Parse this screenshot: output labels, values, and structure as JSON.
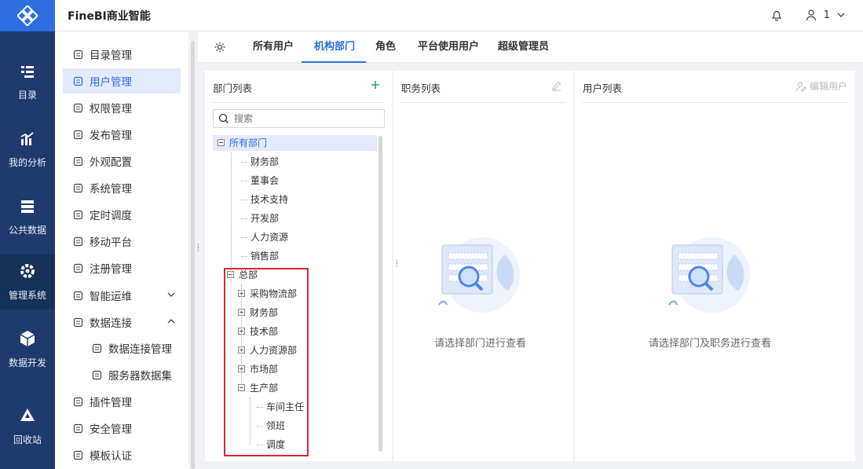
{
  "app": {
    "title": "FineBI商业智能",
    "user": "1"
  },
  "rail": [
    {
      "label": "目录",
      "icon": "catalog-icon"
    },
    {
      "label": "我的分析",
      "icon": "analysis-icon"
    },
    {
      "label": "公共数据",
      "icon": "public-data-icon"
    },
    {
      "label": "管理系统",
      "icon": "management-icon",
      "active": true
    },
    {
      "label": "数据开发",
      "icon": "data-dev-icon"
    },
    {
      "label": "回收站",
      "icon": "recycle-icon"
    }
  ],
  "nav": {
    "items": [
      {
        "label": "目录管理",
        "icon": "catalog-manage-icon"
      },
      {
        "label": "用户管理",
        "icon": "user-manage-icon",
        "active": true
      },
      {
        "label": "权限管理",
        "icon": "permission-icon"
      },
      {
        "label": "发布管理",
        "icon": "publish-icon"
      },
      {
        "label": "外观配置",
        "icon": "appearance-icon"
      },
      {
        "label": "系统管理",
        "icon": "system-gear-icon"
      },
      {
        "label": "定时调度",
        "icon": "timer-icon"
      },
      {
        "label": "移动平台",
        "icon": "mobile-icon"
      },
      {
        "label": "注册管理",
        "icon": "register-icon"
      },
      {
        "label": "智能运维",
        "icon": "ops-icon",
        "caret": "down"
      },
      {
        "label": "数据连接",
        "icon": "link-icon",
        "caret": "up"
      },
      {
        "label": "数据连接管理",
        "icon": "db-link-icon",
        "sub": true
      },
      {
        "label": "服务器数据集",
        "icon": "server-dataset-icon",
        "sub": true
      },
      {
        "label": "插件管理",
        "icon": "plugin-icon"
      },
      {
        "label": "安全管理",
        "icon": "security-icon"
      },
      {
        "label": "模板认证",
        "icon": "template-cert-icon"
      }
    ]
  },
  "tabs": [
    "所有用户",
    "机构部门",
    "角色",
    "平台使用用户",
    "超级管理员"
  ],
  "active_tab": "机构部门",
  "dept_panel": {
    "title": "部门列表",
    "search_placeholder": "搜索",
    "tree": [
      {
        "label": "所有部门",
        "level": 0,
        "toggle": "minus",
        "selected": true
      },
      {
        "label": "财务部",
        "level": 1
      },
      {
        "label": "董事会",
        "level": 1
      },
      {
        "label": "技术支持",
        "level": 1
      },
      {
        "label": "开发部",
        "level": 1
      },
      {
        "label": "人力资源",
        "level": 1
      },
      {
        "label": "销售部",
        "level": 1
      },
      {
        "label": "总部",
        "level": 1,
        "toggle": "minus"
      },
      {
        "label": "采购物流部",
        "level": 2,
        "toggle": "plus"
      },
      {
        "label": "财务部",
        "level": 2,
        "toggle": "plus"
      },
      {
        "label": "技术部",
        "level": 2,
        "toggle": "plus"
      },
      {
        "label": "人力资源部",
        "level": 2,
        "toggle": "plus"
      },
      {
        "label": "市场部",
        "level": 2,
        "toggle": "plus"
      },
      {
        "label": "生产部",
        "level": 2,
        "toggle": "minus"
      },
      {
        "label": "车间主任",
        "level": 3
      },
      {
        "label": "领班",
        "level": 3
      },
      {
        "label": "调度",
        "level": 3
      }
    ]
  },
  "position_panel": {
    "title": "职务列表",
    "empty_text": "请选择部门进行查看"
  },
  "user_panel": {
    "title": "用户列表",
    "edit_label": "编辑用户",
    "empty_text": "请选择部门及职务进行查看"
  },
  "colors": {
    "accent": "#2d6fe0",
    "rail": "#1f3a6d",
    "highlight": "#e0242f"
  }
}
